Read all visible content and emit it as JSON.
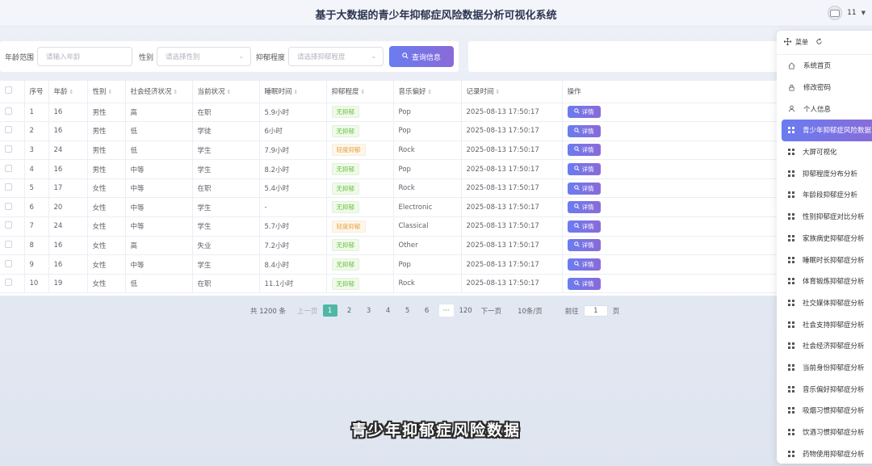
{
  "header": {
    "title": "基于大数据的青少年抑郁症风险数据分析可视化系统",
    "user": "11"
  },
  "filters": {
    "age_label": "年龄范围",
    "age_placeholder": "请输入年龄",
    "gender_label": "性别",
    "gender_placeholder": "请选择性别",
    "depression_label": "抑郁程度",
    "depression_placeholder": "请选择抑郁程度",
    "query_label": "查询信息"
  },
  "table": {
    "headers": [
      "序号",
      "年龄",
      "性别",
      "社会经济状况",
      "当前状况",
      "睡眠时间",
      "抑郁程度",
      "音乐偏好",
      "记录时间",
      "操作"
    ],
    "detail_label": "详情",
    "rows": [
      {
        "no": "1",
        "age": "16",
        "gender": "男性",
        "ses": "高",
        "status": "在职",
        "sleep": "5.9小时",
        "level": "无抑郁",
        "music": "Pop",
        "time": "2025-08-13 17:50:17"
      },
      {
        "no": "2",
        "age": "16",
        "gender": "男性",
        "ses": "低",
        "status": "学徒",
        "sleep": "6小时",
        "level": "无抑郁",
        "music": "Pop",
        "time": "2025-08-13 17:50:17"
      },
      {
        "no": "3",
        "age": "24",
        "gender": "男性",
        "ses": "低",
        "status": "学生",
        "sleep": "7.9小时",
        "level": "轻度抑郁",
        "music": "Rock",
        "time": "2025-08-13 17:50:17"
      },
      {
        "no": "4",
        "age": "16",
        "gender": "男性",
        "ses": "中等",
        "status": "学生",
        "sleep": "8.2小时",
        "level": "无抑郁",
        "music": "Pop",
        "time": "2025-08-13 17:50:17"
      },
      {
        "no": "5",
        "age": "17",
        "gender": "女性",
        "ses": "中等",
        "status": "在职",
        "sleep": "5.4小时",
        "level": "无抑郁",
        "music": "Rock",
        "time": "2025-08-13 17:50:17"
      },
      {
        "no": "6",
        "age": "20",
        "gender": "女性",
        "ses": "中等",
        "status": "学生",
        "sleep": "-",
        "level": "无抑郁",
        "music": "Electronic",
        "time": "2025-08-13 17:50:17"
      },
      {
        "no": "7",
        "age": "24",
        "gender": "女性",
        "ses": "中等",
        "status": "学生",
        "sleep": "5.7小时",
        "level": "轻度抑郁",
        "music": "Classical",
        "time": "2025-08-13 17:50:17"
      },
      {
        "no": "8",
        "age": "16",
        "gender": "女性",
        "ses": "高",
        "status": "失业",
        "sleep": "7.2小时",
        "level": "无抑郁",
        "music": "Other",
        "time": "2025-08-13 17:50:17"
      },
      {
        "no": "9",
        "age": "16",
        "gender": "女性",
        "ses": "中等",
        "status": "学生",
        "sleep": "8.4小时",
        "level": "无抑郁",
        "music": "Pop",
        "time": "2025-08-13 17:50:17"
      },
      {
        "no": "10",
        "age": "19",
        "gender": "女性",
        "ses": "低",
        "status": "在职",
        "sleep": "11.1小时",
        "level": "无抑郁",
        "music": "Rock",
        "time": "2025-08-13 17:50:17"
      }
    ]
  },
  "pagination": {
    "total": "共 1200 条",
    "prev": "上一页",
    "next": "下一页",
    "pages": [
      "1",
      "2",
      "3",
      "4",
      "5",
      "6"
    ],
    "ellipsis": "···",
    "last": "120",
    "page_size": "10条/页",
    "goto": "前往",
    "goto_value": "1",
    "page_unit": "页"
  },
  "menu": {
    "title": "菜单",
    "items": [
      {
        "label": "系统首页",
        "icon": "home-icon"
      },
      {
        "label": "修改密码",
        "icon": "lock-icon"
      },
      {
        "label": "个人信息",
        "icon": "user-icon"
      },
      {
        "label": "青少年抑郁症风险数据",
        "icon": "grid-icon",
        "active": true
      },
      {
        "label": "大屏可视化",
        "icon": "grid-icon"
      },
      {
        "label": "抑郁程度分布分析",
        "icon": "grid-icon"
      },
      {
        "label": "年龄段抑郁症分析",
        "icon": "grid-icon"
      },
      {
        "label": "性别抑郁症对比分析",
        "icon": "grid-icon"
      },
      {
        "label": "家族病史抑郁症分析",
        "icon": "grid-icon"
      },
      {
        "label": "睡眠时长抑郁症分析",
        "icon": "grid-icon"
      },
      {
        "label": "体育锻炼抑郁症分析",
        "icon": "grid-icon"
      },
      {
        "label": "社交媒体抑郁症分析",
        "icon": "grid-icon"
      },
      {
        "label": "社会支持抑郁症分析",
        "icon": "grid-icon"
      },
      {
        "label": "社会经济抑郁症分析",
        "icon": "grid-icon"
      },
      {
        "label": "当前身份抑郁症分析",
        "icon": "grid-icon"
      },
      {
        "label": "音乐偏好抑郁症分析",
        "icon": "grid-icon"
      },
      {
        "label": "吸烟习惯抑郁症分析",
        "icon": "grid-icon"
      },
      {
        "label": "饮酒习惯抑郁症分析",
        "icon": "grid-icon"
      },
      {
        "label": "药物使用抑郁症分析",
        "icon": "grid-icon"
      }
    ]
  },
  "overlay": {
    "subtitle": "青少年抑郁症风险数据"
  },
  "colors": {
    "accent": "#7a74e6",
    "pager_active": "#4fb7a5",
    "tag_none": "#67c23a",
    "tag_mild": "#e6a23c"
  }
}
